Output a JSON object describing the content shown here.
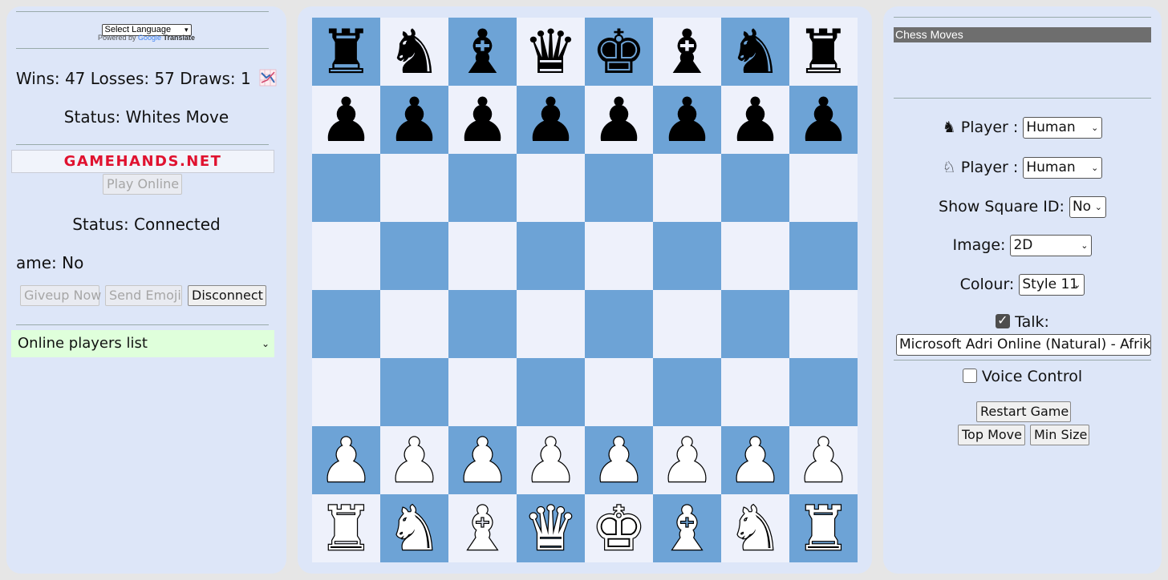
{
  "left": {
    "language_select": "Select Language",
    "powered_by": "Powered by",
    "google": "Google",
    "translate": "Translate",
    "score": "Wins: 47 Losses: 57 Draws: 1",
    "status_move": "Status: Whites Move",
    "banner": "GAMEHANDS.NET",
    "play_online": "Play Online",
    "status_connected": "Status: Connected",
    "game_label": "ame: No",
    "giveup": "Giveup Now",
    "send_emoji": "Send Emoji",
    "disconnect": "Disconnect",
    "players_list": "Online players list"
  },
  "board": {
    "ranks": [
      [
        "br",
        "bn",
        "bb",
        "bq",
        "bk",
        "bb",
        "bn",
        "br"
      ],
      [
        "bp",
        "bp",
        "bp",
        "bp",
        "bp",
        "bp",
        "bp",
        "bp"
      ],
      [
        "",
        "",
        "",
        "",
        "",
        "",
        "",
        ""
      ],
      [
        "",
        "",
        "",
        "",
        "",
        "",
        "",
        ""
      ],
      [
        "",
        "",
        "",
        "",
        "",
        "",
        "",
        ""
      ],
      [
        "",
        "",
        "",
        "",
        "",
        "",
        "",
        ""
      ],
      [
        "wp",
        "wp",
        "wp",
        "wp",
        "wp",
        "wp",
        "wp",
        "wp"
      ],
      [
        "wr",
        "wn",
        "wb",
        "wq",
        "wk",
        "wb",
        "wn",
        "wr"
      ]
    ],
    "colors": {
      "dark": "#6da3d6",
      "light": "#eef1fb"
    }
  },
  "right": {
    "moves_header": "Chess Moves",
    "player_label": "Player :",
    "black_player": "Human",
    "white_player": "Human",
    "show_square_label": "Show Square ID:",
    "show_square_value": "No",
    "image_label": "Image:",
    "image_value": "2D",
    "colour_label": "Colour:",
    "colour_value": "Style 11",
    "talk_label": "Talk:",
    "talk_checked": true,
    "voice": "Microsoft Adri Online (Natural) - Afrikaans",
    "voice_control_label": "Voice Control",
    "voice_control_checked": false,
    "restart": "Restart Game",
    "top_move": "Top Move",
    "min_size": "Min Size"
  }
}
